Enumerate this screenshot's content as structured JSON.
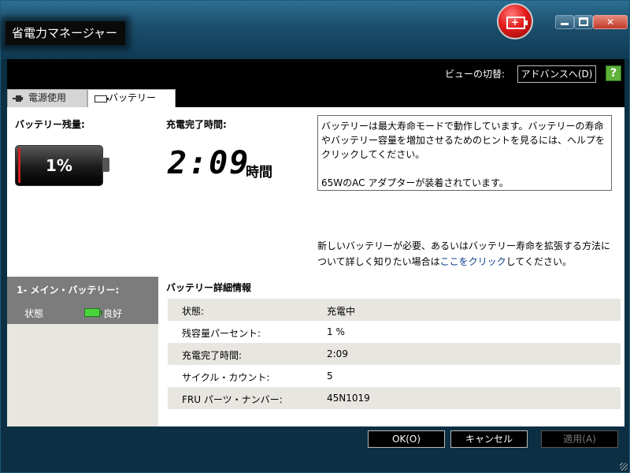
{
  "window": {
    "title": "省電力マネージャー",
    "controls": {
      "minimize": "",
      "maximize": "",
      "close": "✕"
    }
  },
  "view_bar": {
    "label": "ビューの切替:",
    "button": "アドバンスへ(D)",
    "help": "?"
  },
  "tabs": [
    {
      "label": "電源使用",
      "icon": "plug-icon"
    },
    {
      "label": "バッテリー",
      "icon": "battery-icon",
      "active": true
    }
  ],
  "summary": {
    "remaining_label": "バッテリー残量:",
    "percent": "1%",
    "level": 0.01,
    "charge_label": "充電完了時間:",
    "charge_time": "2:09",
    "charge_unit": "時間",
    "info_lines": [
      "バッテリーは最大寿命モードで動作しています。バッテリーの寿命やバッテリー容量を増加させるためのヒントを見るには、ヘルプをクリックしてください。",
      "65WのAC アダプターが装着されています。"
    ],
    "new_battery_prefix": "新しいバッテリーが必要、あるいはバッテリー寿命を拡張する方法について詳しく知りたい場合は",
    "new_battery_link": "ここをクリック",
    "new_battery_suffix": "してください。"
  },
  "battery_panel": {
    "name": "1- メイン・バッテリー:",
    "status_label": "状態",
    "status_value": "良好",
    "status_color": "#49d43b"
  },
  "details": {
    "title": "バッテリー詳細情報",
    "rows": [
      {
        "key": "状態:",
        "value": "充電中"
      },
      {
        "key": "残容量パーセント:",
        "value": "1 %"
      },
      {
        "key": "充電完了時間:",
        "value": "2:09"
      },
      {
        "key": "サイクル・カウント:",
        "value": "5"
      },
      {
        "key": "FRU パーツ・ナンバー:",
        "value": "45N1019"
      }
    ]
  },
  "footer": {
    "ok": "OK(O)",
    "cancel": "キャンセル",
    "apply": "適用(A)"
  },
  "colors": {
    "titlebar": "#1b4e6c",
    "logo": "#e51c1c",
    "link": "#0a3d8a"
  }
}
